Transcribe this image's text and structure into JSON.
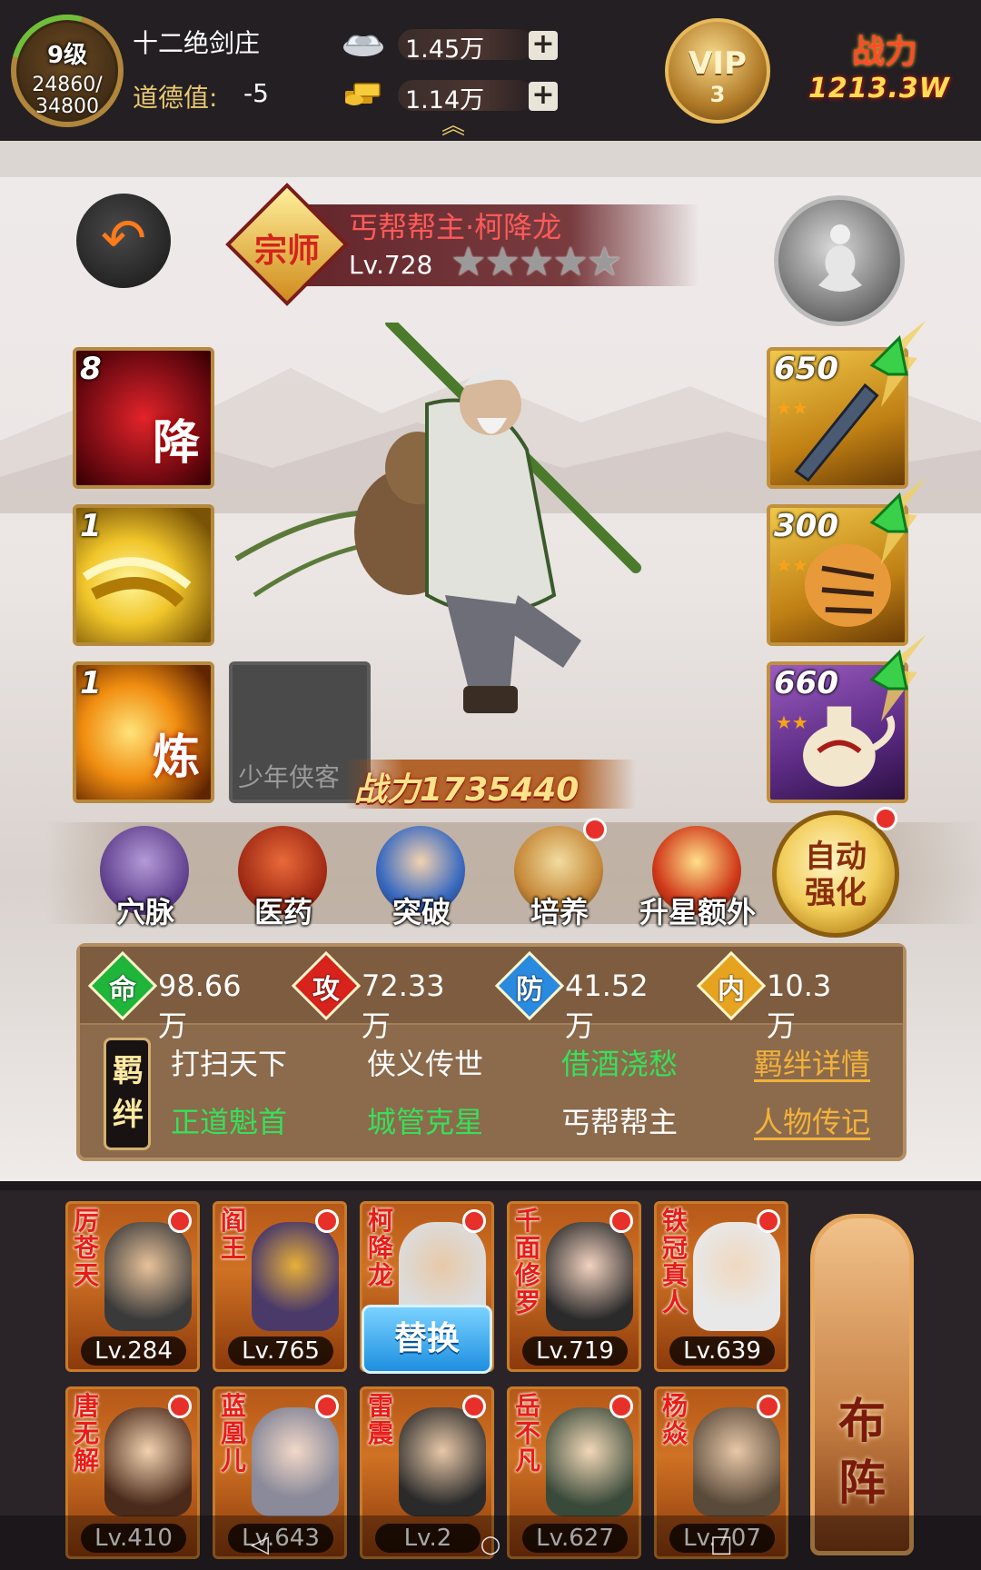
{
  "header": {
    "level": "9级",
    "exp": "24860/",
    "exp_max": "34800",
    "guild": "十二绝剑庄",
    "morality_label": "道德值:",
    "morality_value": "-5",
    "silver": "1.45万",
    "gold": "1.14万",
    "plus": "+",
    "vip_label": "VIP",
    "vip_level": "3",
    "power_label": "战力",
    "power_value": "1213.3W"
  },
  "hero": {
    "rank": "宗师",
    "name": "丐帮帮主·柯降龙",
    "level": "Lv.728",
    "stars_text": "★★★★★",
    "stars": 5,
    "combat_power": "战力1735440",
    "back_icon": "back-arrow-icon",
    "meditate_icon": "meditation-figure-icon"
  },
  "skills": [
    {
      "num": "8",
      "char": "降"
    },
    {
      "num": "1",
      "char": ""
    },
    {
      "num": "1",
      "char": "炼"
    }
  ],
  "empty_slot_label": "少年侠客",
  "equipment": [
    {
      "num": "650",
      "stars": "★★"
    },
    {
      "num": "300",
      "stars": "★★★"
    },
    {
      "num": "660",
      "stars": "★★"
    }
  ],
  "functions": [
    {
      "label": "穴脉",
      "icon": "meridian-icon",
      "badge": false
    },
    {
      "label": "医药",
      "icon": "medicine-icon",
      "badge": false
    },
    {
      "label": "突破",
      "icon": "breakthrough-icon",
      "badge": false
    },
    {
      "label": "培养",
      "icon": "scroll-icon",
      "badge": true
    },
    {
      "label": "升星额外",
      "icon": "star-upgrade-icon",
      "badge": false
    }
  ],
  "auto_enhance": "自动强化",
  "stats": [
    {
      "char": "命",
      "value": "98.66万",
      "color": "#1fb53a"
    },
    {
      "char": "攻",
      "value": "72.33万",
      "color": "#d8221c"
    },
    {
      "char": "防",
      "value": "41.52万",
      "color": "#2a8ae0"
    },
    {
      "char": "内",
      "value": "10.3万",
      "color": "#e6a320"
    }
  ],
  "bonds_label": "羁绊",
  "bonds": [
    {
      "text": "打扫天下",
      "active": false
    },
    {
      "text": "侠义传世",
      "active": false
    },
    {
      "text": "借酒浇愁",
      "active": true
    },
    {
      "text": "正道魁首",
      "active": true
    },
    {
      "text": "城管克星",
      "active": true
    },
    {
      "text": "丐帮帮主",
      "active": false
    }
  ],
  "bond_links": [
    "羁绊详情",
    "人物传记"
  ],
  "roster": [
    {
      "name": "厉苍天",
      "level": "Lv.284"
    },
    {
      "name": "阎王",
      "level": "Lv.765"
    },
    {
      "name": "柯降龙",
      "level": ""
    },
    {
      "name": "千面修罗",
      "level": "Lv.719"
    },
    {
      "name": "铁冠真人",
      "level": "Lv.639"
    },
    {
      "name": "唐无解",
      "level": "Lv.410"
    },
    {
      "name": "蓝凰儿",
      "level": "Lv.643"
    },
    {
      "name": "雷震",
      "level": "Lv.2"
    },
    {
      "name": "岳不凡",
      "level": "Lv.627"
    },
    {
      "name": "杨焱",
      "level": "Lv.707"
    }
  ],
  "replace_label": "替换",
  "formation_label": "布阵"
}
